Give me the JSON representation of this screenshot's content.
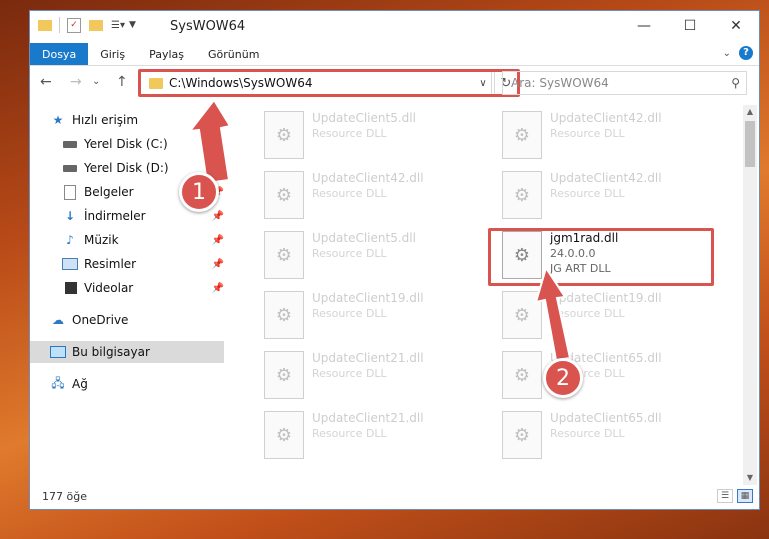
{
  "window": {
    "title": "SysWOW64",
    "controls": {
      "minimize": "—",
      "maximize": "☐",
      "close": "✕"
    }
  },
  "ribbon": {
    "tabs": [
      "Dosya",
      "Giriş",
      "Paylaş",
      "Görünüm"
    ],
    "help": "?"
  },
  "navigation": {
    "back": "←",
    "forward": "→",
    "recent": "⌄",
    "up": "↑",
    "address": "C:\\Windows\\SysWOW64",
    "refresh": "↻",
    "search_placeholder": "Ara: SysWOW64"
  },
  "sidebar": {
    "items": [
      {
        "label": "Hızlı erişim",
        "icon": "star-icon"
      },
      {
        "label": "Yerel Disk (C:)",
        "icon": "drive-icon",
        "pinned": true
      },
      {
        "label": "Yerel Disk (D:)",
        "icon": "drive-icon",
        "pinned": true
      },
      {
        "label": "Belgeler",
        "icon": "document-icon",
        "pinned": true
      },
      {
        "label": "İndirmeler",
        "icon": "download-icon",
        "pinned": true
      },
      {
        "label": "Müzik",
        "icon": "music-icon",
        "pinned": true
      },
      {
        "label": "Resimler",
        "icon": "pictures-icon",
        "pinned": true
      },
      {
        "label": "Videolar",
        "icon": "video-icon",
        "pinned": true
      },
      {
        "label": "OneDrive",
        "icon": "cloud-icon"
      },
      {
        "label": "Bu bilgisayar",
        "icon": "computer-icon",
        "selected": true
      },
      {
        "label": "Ağ",
        "icon": "network-icon"
      }
    ]
  },
  "files": {
    "left_column": [
      {
        "name": "UpdateClient5.dll",
        "type": "Resource DLL"
      },
      {
        "name": "UpdateClient42.dll",
        "type": "Resource DLL"
      },
      {
        "name": "UpdateClient5.dll",
        "type": "Resource DLL"
      },
      {
        "name": "UpdateClient19.dll",
        "type": "Resource DLL"
      },
      {
        "name": "UpdateClient21.dll",
        "type": "Resource DLL"
      },
      {
        "name": "UpdateClient21.dll",
        "type": "Resource DLL"
      }
    ],
    "right_column": [
      {
        "name": "UpdateClient42.dll",
        "type": "Resource DLL"
      },
      {
        "name": "UpdateClient42.dll",
        "type": "Resource DLL"
      },
      {
        "name": "jgm1rad.dll",
        "version": "24.0.0.0",
        "type": "JG ART DLL"
      },
      {
        "name": "UpdateClient19.dll",
        "type": "Resource DLL"
      },
      {
        "name": "UpdateClient65.dll",
        "type": "Resource DLL"
      },
      {
        "name": "UpdateClient65.dll",
        "type": "Resource DLL"
      }
    ]
  },
  "status": {
    "item_count": "177 öğe"
  },
  "annotations": {
    "step1": "1",
    "step2": "2",
    "color": "#d9534f"
  }
}
